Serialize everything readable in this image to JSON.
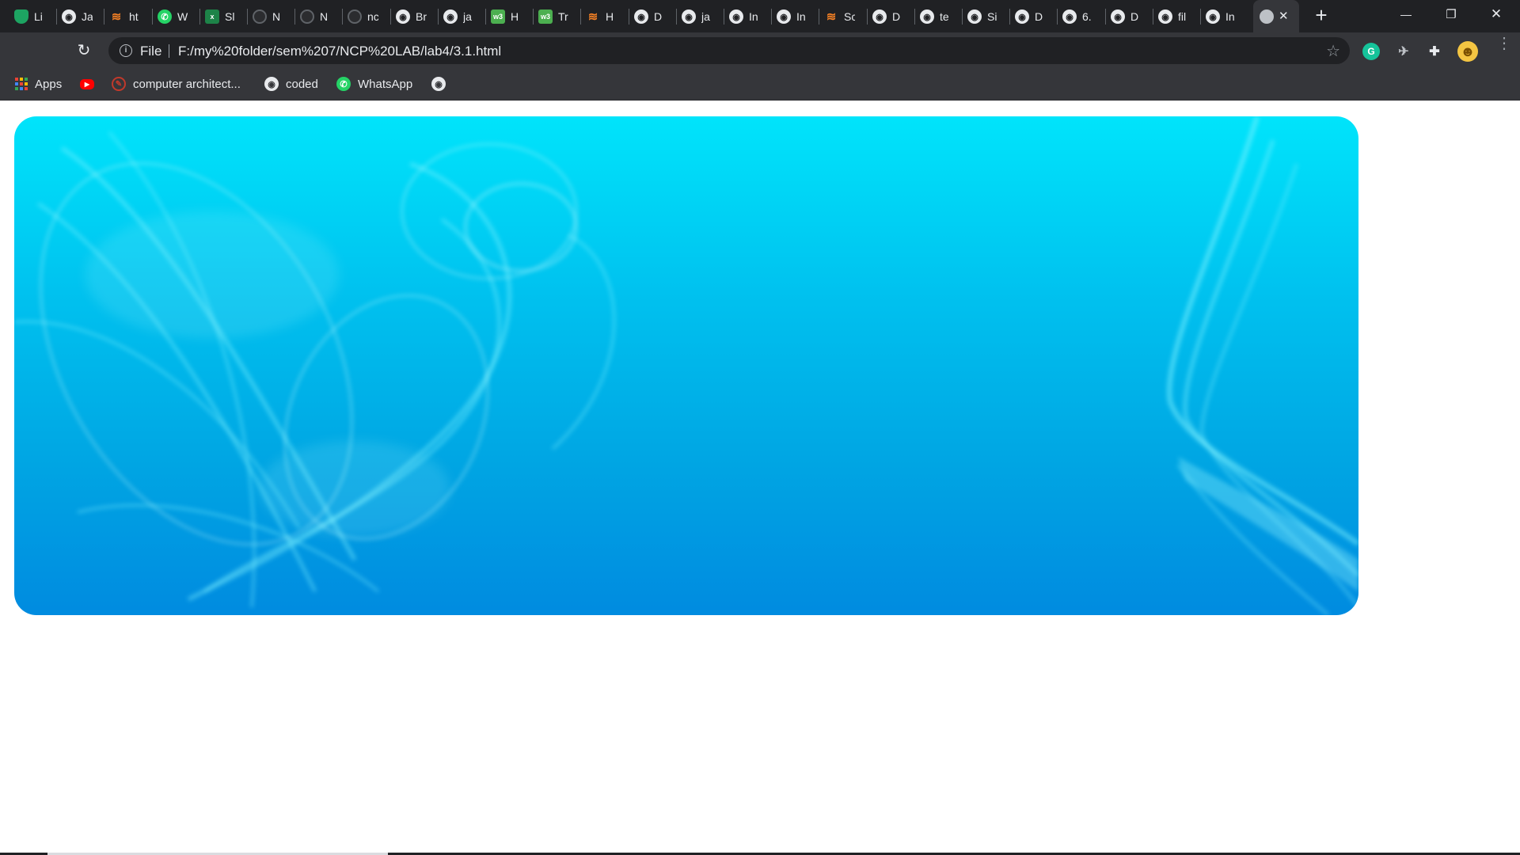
{
  "tabs": [
    {
      "title": "Li",
      "icon": "green-shield-icon",
      "color": "#1da462",
      "glyph": ""
    },
    {
      "title": "Ja",
      "icon": "globe-icon",
      "color": "#e8eaed",
      "glyph": ""
    },
    {
      "title": "ht",
      "icon": "stackoverflow-icon",
      "color": "#f48024",
      "glyph": ""
    },
    {
      "title": "W",
      "icon": "whatsapp-icon",
      "color": "#25d366",
      "glyph": ""
    },
    {
      "title": "Sl",
      "icon": "excel-icon",
      "color": "#1d8348",
      "glyph": "x"
    },
    {
      "title": "N",
      "icon": "github-icon",
      "color": "#2b2c2f",
      "glyph": ""
    },
    {
      "title": "N",
      "icon": "github-icon",
      "color": "#2b2c2f",
      "glyph": ""
    },
    {
      "title": "nc",
      "icon": "github-icon",
      "color": "#2b2c2f",
      "glyph": ""
    },
    {
      "title": "Br",
      "icon": "globe-icon",
      "color": "#e8eaed",
      "glyph": ""
    },
    {
      "title": "ja",
      "icon": "globe-icon",
      "color": "#e8eaed",
      "glyph": ""
    },
    {
      "title": "H",
      "icon": "w3schools-icon",
      "color": "#4caf50",
      "glyph": "w3"
    },
    {
      "title": "Tr",
      "icon": "w3schools-icon",
      "color": "#4caf50",
      "glyph": "w3"
    },
    {
      "title": "H",
      "icon": "stackoverflow-icon",
      "color": "#f48024",
      "glyph": ""
    },
    {
      "title": "D",
      "icon": "globe-icon",
      "color": "#e8eaed",
      "glyph": ""
    },
    {
      "title": "ja",
      "icon": "globe-icon",
      "color": "#e8eaed",
      "glyph": ""
    },
    {
      "title": "In",
      "icon": "globe-icon",
      "color": "#e8eaed",
      "glyph": ""
    },
    {
      "title": "In",
      "icon": "globe-icon",
      "color": "#e8eaed",
      "glyph": ""
    },
    {
      "title": "Sc",
      "icon": "stackoverflow-icon",
      "color": "#f48024",
      "glyph": ""
    },
    {
      "title": "D",
      "icon": "globe-icon",
      "color": "#e8eaed",
      "glyph": ""
    },
    {
      "title": "te",
      "icon": "globe-icon",
      "color": "#e8eaed",
      "glyph": ""
    },
    {
      "title": "Si",
      "icon": "globe-icon",
      "color": "#e8eaed",
      "glyph": ""
    },
    {
      "title": "D",
      "icon": "globe-icon",
      "color": "#e8eaed",
      "glyph": ""
    },
    {
      "title": "6.",
      "icon": "globe-icon",
      "color": "#e8eaed",
      "glyph": ""
    },
    {
      "title": "D",
      "icon": "globe-icon",
      "color": "#e8eaed",
      "glyph": ""
    },
    {
      "title": "fil",
      "icon": "globe-icon",
      "color": "#e8eaed",
      "glyph": ""
    },
    {
      "title": "In",
      "icon": "globe-icon",
      "color": "#e8eaed",
      "glyph": ""
    }
  ],
  "active_tab": {
    "icon": "globe-icon",
    "close_glyph": "✕"
  },
  "new_tab_glyph": "+",
  "window_controls": {
    "minimize": "—",
    "restore": "❐",
    "close": "✕"
  },
  "toolbar": {
    "reload_glyph": "↻",
    "scheme_label": "File",
    "url": "F:/my%20folder/sem%207/NCP%20LAB/lab4/3.1.html",
    "star_glyph": "☆",
    "extensions": [
      {
        "name": "grammarly-icon",
        "glyph": "G",
        "color": "#15c39a"
      },
      {
        "name": "extension-puzzle-icon",
        "glyph": "✈",
        "color": "#35363a"
      },
      {
        "name": "puzzle-icon",
        "glyph": "✚",
        "color": "#35363a"
      },
      {
        "name": "profile-avatar-icon",
        "glyph": "☻",
        "color": "#f4c542"
      }
    ],
    "menu_glyph": "⋮"
  },
  "bookmarks": [
    {
      "label": "Apps",
      "icon": "apps-grid-icon"
    },
    {
      "label": "",
      "icon": "youtube-icon"
    },
    {
      "label": "computer architect...",
      "icon": "bookmark-red-icon"
    },
    {
      "label": "coded",
      "icon": "globe-icon"
    },
    {
      "label": "WhatsApp",
      "icon": "whatsapp-icon"
    },
    {
      "label": "",
      "icon": "globe-icon"
    }
  ],
  "banner": {
    "top_color": "#00e4fb",
    "bottom_color": "#008be0"
  }
}
